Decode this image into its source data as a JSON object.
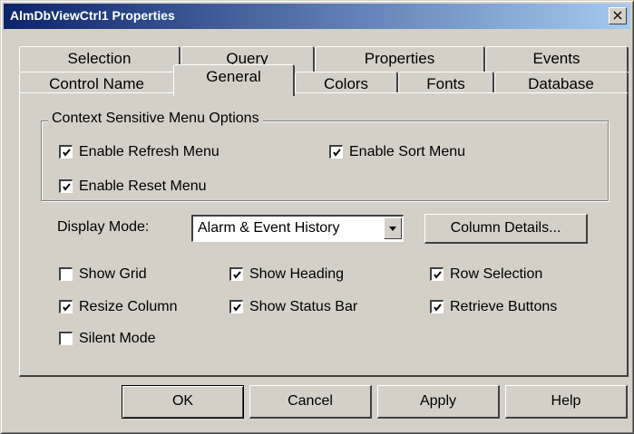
{
  "window": {
    "title": "AlmDbViewCtrl1 Properties",
    "close_label": "×"
  },
  "tabs": {
    "back_row": [
      "Selection",
      "Query",
      "Properties",
      "Events"
    ],
    "front_row": [
      "Control Name",
      "General",
      "Colors",
      "Fonts",
      "Database"
    ],
    "active": "General"
  },
  "context_menu_group": {
    "label": "Context Sensitive Menu Options",
    "options": [
      {
        "label": "Enable Refresh Menu",
        "checked": true
      },
      {
        "label": "Enable Sort Menu",
        "checked": true
      },
      {
        "label": "Enable Reset Menu",
        "checked": true
      }
    ]
  },
  "display_mode": {
    "label": "Display Mode:",
    "value": "Alarm & Event History"
  },
  "column_details_label": "Column Details...",
  "options": [
    {
      "label": "Show Grid",
      "checked": false
    },
    {
      "label": "Show Heading",
      "checked": true
    },
    {
      "label": "Row Selection",
      "checked": true
    },
    {
      "label": "Resize Column",
      "checked": true
    },
    {
      "label": "Show Status Bar",
      "checked": true
    },
    {
      "label": "Retrieve Buttons",
      "checked": true
    },
    {
      "label": "Silent Mode",
      "checked": false
    }
  ],
  "buttons": {
    "ok": "OK",
    "cancel": "Cancel",
    "apply": "Apply",
    "help": "Help"
  },
  "colors": {
    "titlebar_start": "#0a246a",
    "titlebar_end": "#a6caf0",
    "face": "#d4d0c8"
  }
}
